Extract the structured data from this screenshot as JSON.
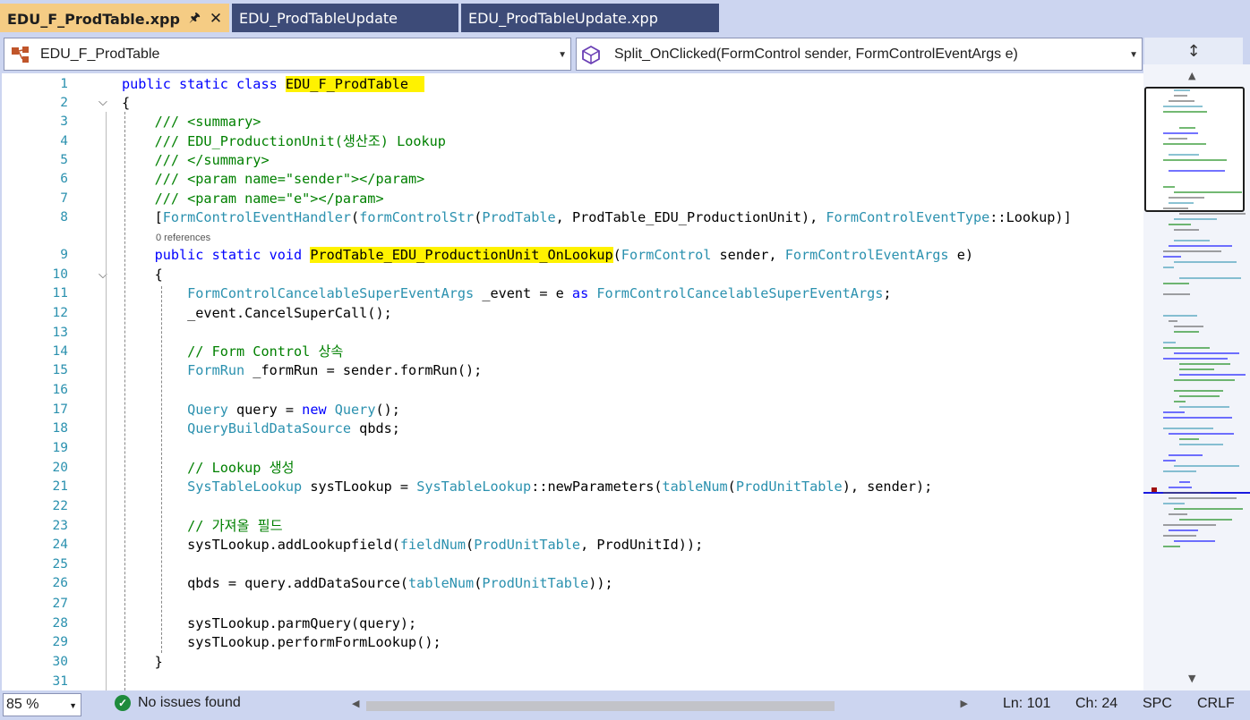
{
  "tabs": [
    {
      "label": "EDU_F_ProdTable.xpp",
      "active": true
    },
    {
      "label": "EDU_ProdTableUpdate",
      "active": false
    },
    {
      "label": "EDU_ProdTableUpdate.xpp",
      "active": false
    }
  ],
  "nav": {
    "left_dropdown": "EDU_F_ProdTable",
    "right_dropdown": "Split_OnClicked(FormControl sender, FormControlEventArgs e)"
  },
  "code_lens": "0 references",
  "lines": [
    {
      "n": "1"
    },
    {
      "n": "2"
    },
    {
      "n": "3"
    },
    {
      "n": "4"
    },
    {
      "n": "5"
    },
    {
      "n": "6"
    },
    {
      "n": "7"
    },
    {
      "n": "8"
    },
    {
      "n": "9"
    },
    {
      "n": "10"
    },
    {
      "n": "11"
    },
    {
      "n": "12"
    },
    {
      "n": "13"
    },
    {
      "n": "14"
    },
    {
      "n": "15"
    },
    {
      "n": "16"
    },
    {
      "n": "17"
    },
    {
      "n": "18"
    },
    {
      "n": "19"
    },
    {
      "n": "20"
    },
    {
      "n": "21"
    },
    {
      "n": "22"
    },
    {
      "n": "23"
    },
    {
      "n": "24"
    },
    {
      "n": "25"
    },
    {
      "n": "26"
    },
    {
      "n": "27"
    },
    {
      "n": "28"
    },
    {
      "n": "29"
    },
    {
      "n": "30"
    },
    {
      "n": "31"
    }
  ],
  "code": {
    "l1": [
      [
        "kw",
        "public static class "
      ],
      [
        "hl",
        "EDU_F_ProdTable  "
      ]
    ],
    "l2": [
      [
        "",
        "{"
      ]
    ],
    "l3": [
      [
        "cm",
        "    /// <summary>"
      ]
    ],
    "l4": [
      [
        "cm",
        "    /// EDU_ProductionUnit(생산조) Lookup"
      ]
    ],
    "l5": [
      [
        "cm",
        "    /// </summary>"
      ]
    ],
    "l6": [
      [
        "cm",
        "    /// <param name=\"sender\"></param>"
      ]
    ],
    "l7": [
      [
        "cm",
        "    /// <param name=\"e\"></param>"
      ]
    ],
    "l8": [
      [
        "",
        "    ["
      ],
      [
        "ty",
        "FormControlEventHandler"
      ],
      [
        "",
        "("
      ],
      [
        "ty",
        "formControlStr"
      ],
      [
        "",
        "("
      ],
      [
        "ty",
        "ProdTable"
      ],
      [
        "",
        ", ProdTable_EDU_ProductionUnit), "
      ],
      [
        "ty",
        "FormControlEventType"
      ],
      [
        "",
        "::Lookup)]"
      ]
    ],
    "l9": [
      [
        "kw",
        "    public static void "
      ],
      [
        "hl",
        "ProdTable_EDU_ProductionUnit_OnLookup"
      ],
      [
        "",
        "("
      ],
      [
        "ty",
        "FormControl"
      ],
      [
        "",
        " sender, "
      ],
      [
        "ty",
        "FormControlEventArgs"
      ],
      [
        "",
        " e)"
      ]
    ],
    "l10": [
      [
        "",
        "    {"
      ]
    ],
    "l11": [
      [
        "ty",
        "        FormControlCancelableSuperEventArgs"
      ],
      [
        "",
        " _event = e "
      ],
      [
        "kw",
        "as "
      ],
      [
        "ty",
        "FormControlCancelableSuperEventArgs"
      ],
      [
        "",
        ";"
      ]
    ],
    "l12": [
      [
        "",
        "        _event.CancelSuperCall();"
      ]
    ],
    "l13": [
      [
        "",
        ""
      ]
    ],
    "l14": [
      [
        "cm",
        "        // Form Control 상속"
      ]
    ],
    "l15": [
      [
        "ty",
        "        FormRun"
      ],
      [
        "",
        " _formRun = sender.formRun();"
      ]
    ],
    "l16": [
      [
        "",
        ""
      ]
    ],
    "l17": [
      [
        "ty",
        "        Query"
      ],
      [
        "",
        " query = "
      ],
      [
        "kw",
        "new "
      ],
      [
        "ty",
        "Query"
      ],
      [
        "",
        "();"
      ]
    ],
    "l18": [
      [
        "ty",
        "        QueryBuildDataSource"
      ],
      [
        "",
        " qbds;"
      ]
    ],
    "l19": [
      [
        "",
        ""
      ]
    ],
    "l20": [
      [
        "cm",
        "        // Lookup 생성"
      ]
    ],
    "l21": [
      [
        "ty",
        "        SysTableLookup"
      ],
      [
        "",
        " sysTLookup = "
      ],
      [
        "ty",
        "SysTableLookup"
      ],
      [
        "",
        "::newParameters("
      ],
      [
        "ty",
        "tableNum"
      ],
      [
        "",
        "("
      ],
      [
        "ty",
        "ProdUnitTable"
      ],
      [
        "",
        "), sender);"
      ]
    ],
    "l22": [
      [
        "",
        ""
      ]
    ],
    "l23": [
      [
        "cm",
        "        // 가져올 필드"
      ]
    ],
    "l24": [
      [
        "",
        "        sysTLookup.addLookupfield("
      ],
      [
        "ty",
        "fieldNum"
      ],
      [
        "",
        "("
      ],
      [
        "ty",
        "ProdUnitTable"
      ],
      [
        "",
        ", ProdUnitId));"
      ]
    ],
    "l25": [
      [
        "",
        ""
      ]
    ],
    "l26": [
      [
        "",
        "        qbds = query.addDataSource("
      ],
      [
        "ty",
        "tableNum"
      ],
      [
        "",
        "("
      ],
      [
        "ty",
        "ProdUnitTable"
      ],
      [
        "",
        "));"
      ]
    ],
    "l27": [
      [
        "",
        ""
      ]
    ],
    "l28": [
      [
        "",
        "        sysTLookup.parmQuery(query);"
      ]
    ],
    "l29": [
      [
        "",
        "        sysTLookup.performFormLookup();"
      ]
    ],
    "l30": [
      [
        "",
        "    }"
      ]
    ],
    "l31": [
      [
        "",
        ""
      ]
    ]
  },
  "status": {
    "zoom": "85 %",
    "issues": "No issues found",
    "ln": "Ln: 101",
    "ch": "Ch: 24",
    "spc": "SPC",
    "crlf": "CRLF"
  }
}
